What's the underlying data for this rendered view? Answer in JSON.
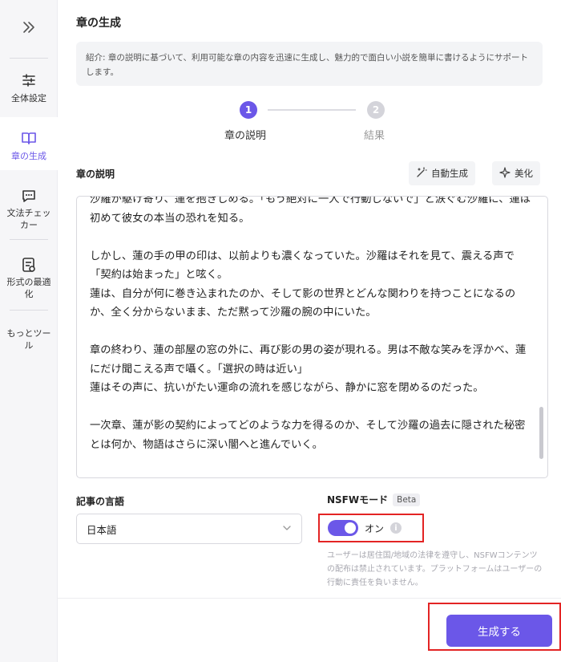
{
  "sidebar": {
    "items": [
      {
        "label": "全体設定",
        "icon": "sliders-icon"
      },
      {
        "label": "章の生成",
        "icon": "book-icon"
      },
      {
        "label": "文法チェッカー",
        "icon": "chat-check-icon"
      },
      {
        "label": "形式の最適化",
        "icon": "format-icon"
      },
      {
        "label": "もっとツール",
        "icon": ""
      }
    ]
  },
  "header": {
    "title": "章の生成",
    "intro": "紹介: 章の説明に基づいて、利用可能な章の内容を迅速に生成し、魅力的で面白い小説を簡単に書けるようにサポートします。"
  },
  "stepper": {
    "steps": [
      {
        "number": "1",
        "label": "章の説明"
      },
      {
        "number": "2",
        "label": "結果"
      }
    ]
  },
  "editor": {
    "label": "章の説明",
    "auto_generate": "自動生成",
    "beautify": "美化",
    "content": "沙羅が駆け寄り、蓮を抱きしめる。「もう絶対に一人で行動しないで」と涙ぐむ沙羅に、蓮は初めて彼女の本当の恐れを知る。\n\nしかし、蓮の手の甲の印は、以前よりも濃くなっていた。沙羅はそれを見て、震える声で「契約は始まった」と呟く。\n蓮は、自分が何に巻き込まれたのか、そして影の世界とどんな関わりを持つことになるのか、全く分からないまま、ただ黙って沙羅の腕の中にいた。\n\n章の終わり、蓮の部屋の窓の外に、再び影の男の姿が現れる。男は不敵な笑みを浮かべ、蓮にだけ聞こえる声で囁く。「選択の時は近い」\n蓮はその声に、抗いがたい運命の流れを感じながら、静かに窓を閉めるのだった。\n\n一次章、蓮が影の契約によってどのような力を得るのか、そして沙羅の過去に隠された秘密とは何か、物語はさらに深い闇へと進んでいく。"
  },
  "language": {
    "label": "記事の言語",
    "value": "日本語"
  },
  "nsfw": {
    "label": "NSFWモード",
    "badge": "Beta",
    "state": "オン",
    "note": "ユーザーは居住国/地域の法律を遵守し、NSFWコンテンツの配布は禁止されています。プラットフォームはユーザーの行動に責任を負いません。"
  },
  "footer": {
    "generate": "生成する"
  },
  "colors": {
    "accent": "#6b57e8",
    "highlight": "#e32424"
  }
}
